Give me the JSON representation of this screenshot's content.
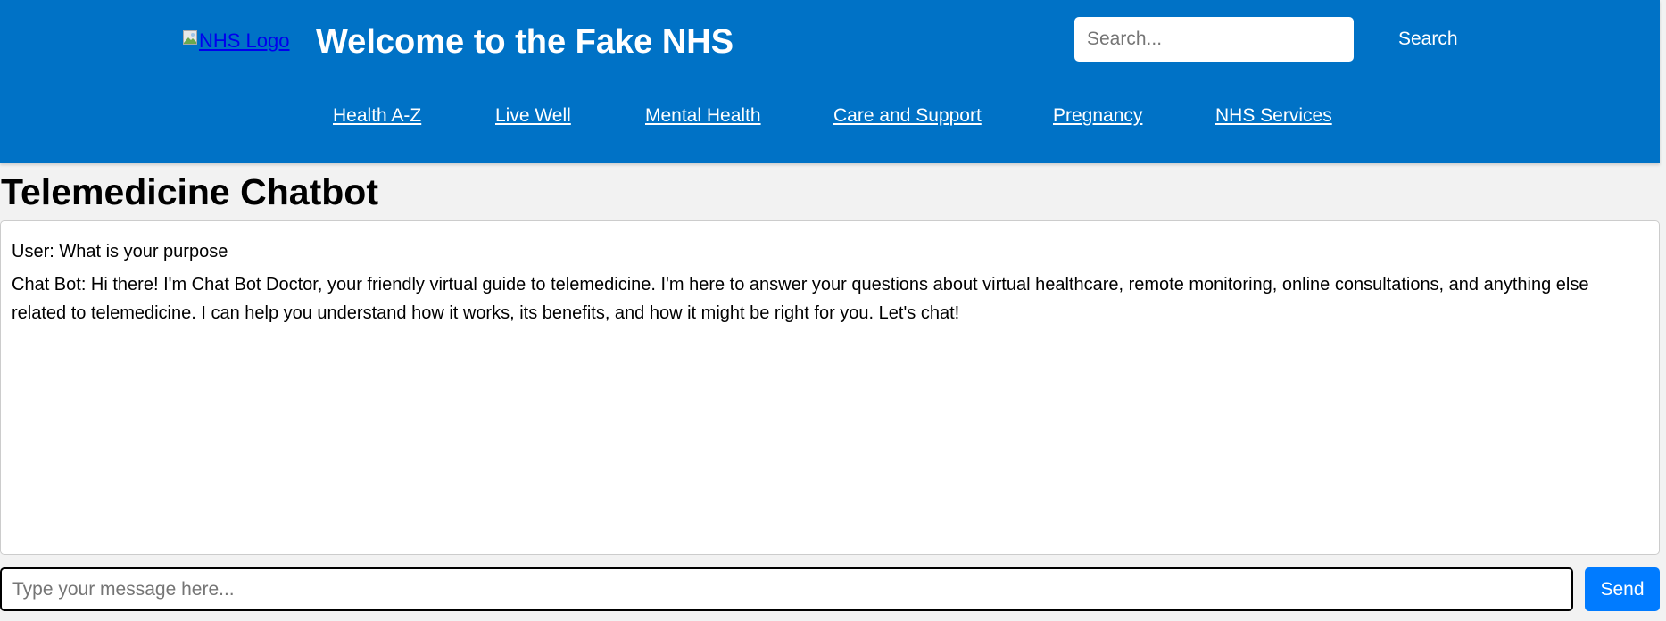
{
  "header": {
    "logo_alt": "NHS Logo",
    "title": "Welcome to the Fake NHS",
    "search_placeholder": "Search...",
    "search_value": "",
    "search_button": "Search"
  },
  "nav": {
    "items": [
      {
        "label": "Health A-Z"
      },
      {
        "label": "Live Well"
      },
      {
        "label": "Mental Health"
      },
      {
        "label": "Care and Support"
      },
      {
        "label": "Pregnancy"
      },
      {
        "label": "NHS Services"
      }
    ]
  },
  "main": {
    "heading": "Telemedicine Chatbot",
    "messages": [
      {
        "text": "User: What is your purpose"
      },
      {
        "text": "Chat Bot: Hi there! I'm Chat Bot Doctor, your friendly virtual guide to telemedicine. I'm here to answer your questions about virtual healthcare, remote monitoring, online consultations, and anything else related to telemedicine. I can help you understand how it works, its benefits, and how it might be right for you. Let's chat!"
      }
    ],
    "input_placeholder": "Type your message here...",
    "input_value": "",
    "send_button": "Send"
  },
  "colors": {
    "header_bg": "#0072c6",
    "page_bg": "#f2f2f2",
    "send_button_bg": "#007bff",
    "link": "#0000ee"
  }
}
